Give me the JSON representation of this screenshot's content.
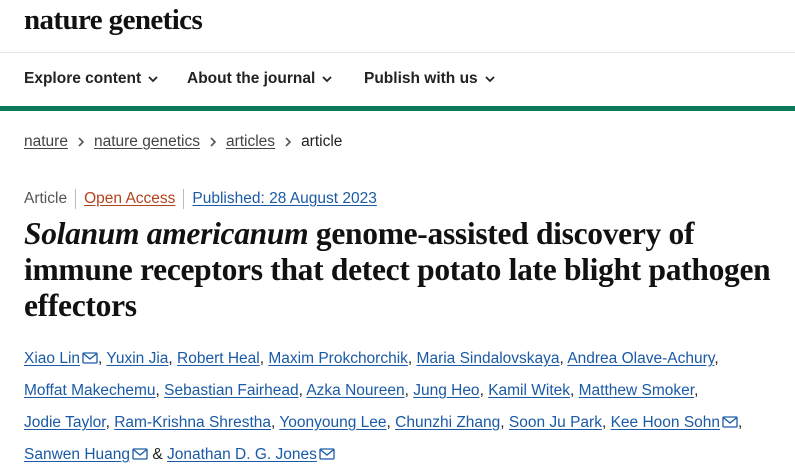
{
  "journal": {
    "name": "nature genetics"
  },
  "nav": {
    "items": [
      {
        "label": "Explore content"
      },
      {
        "label": "About the journal"
      },
      {
        "label": "Publish with us"
      }
    ]
  },
  "breadcrumb": {
    "items": [
      "nature",
      "nature genetics",
      "articles"
    ],
    "current": "article"
  },
  "article": {
    "type": "Article",
    "access": "Open Access",
    "published": "Published: 28 August 2023",
    "title_italic": "Solanum americanum",
    "title_rest": " genome-assisted discovery of immune receptors that detect potato late blight pathogen effectors"
  },
  "authors": [
    {
      "name": "Xiao Lin",
      "email": true
    },
    {
      "name": "Yuxin Jia",
      "email": false
    },
    {
      "name": "Robert Heal",
      "email": false
    },
    {
      "name": "Maxim Prokchorchik",
      "email": false
    },
    {
      "name": "Maria Sindalovskaya",
      "email": false
    },
    {
      "name": "Andrea Olave-Achury",
      "email": false
    },
    {
      "name": "Moffat Makechemu",
      "email": false
    },
    {
      "name": "Sebastian Fairhead",
      "email": false
    },
    {
      "name": "Azka Noureen",
      "email": false
    },
    {
      "name": "Jung Heo",
      "email": false
    },
    {
      "name": "Kamil Witek",
      "email": false
    },
    {
      "name": "Matthew Smoker",
      "email": false
    },
    {
      "name": "Jodie Taylor",
      "email": false
    },
    {
      "name": "Ram-Krishna Shrestha",
      "email": false
    },
    {
      "name": "Yoonyoung Lee",
      "email": false
    },
    {
      "name": "Chunzhi Zhang",
      "email": false
    },
    {
      "name": "Soon Ju Park",
      "email": false
    },
    {
      "name": "Kee Hoon Sohn",
      "email": true
    },
    {
      "name": "Sanwen Huang",
      "email": true
    },
    {
      "name": "Jonathan D. G. Jones",
      "email": true
    }
  ],
  "author_separator": ",",
  "author_final_joiner": "&",
  "colors": {
    "brand_rule": "#0a7a5a",
    "link_blue": "#1a5aa6",
    "open_access": "#b3431d"
  }
}
